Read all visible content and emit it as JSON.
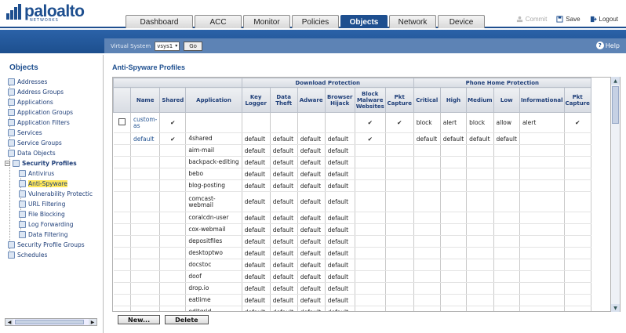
{
  "brand": {
    "name": "paloalto",
    "sub": "NETWORKS"
  },
  "tabs": [
    {
      "label": "Dashboard",
      "active": false
    },
    {
      "label": "ACC",
      "active": false
    },
    {
      "label": "Monitor",
      "active": false
    },
    {
      "label": "Policies",
      "active": false
    },
    {
      "label": "Objects",
      "active": true
    },
    {
      "label": "Network",
      "active": false
    },
    {
      "label": "Device",
      "active": false
    }
  ],
  "top_actions": {
    "commit": "Commit",
    "save": "Save",
    "logout": "Logout"
  },
  "vsys": {
    "label": "Virtual System",
    "value": "vsys1",
    "go": "Go"
  },
  "help": "Help",
  "sidebar": {
    "title": "Objects",
    "items": [
      {
        "label": "Addresses",
        "icon": "address-icon"
      },
      {
        "label": "Address Groups",
        "icon": "address-group-icon"
      },
      {
        "label": "Applications",
        "icon": "applications-icon"
      },
      {
        "label": "Application Groups",
        "icon": "application-group-icon"
      },
      {
        "label": "Application Filters",
        "icon": "application-filter-icon"
      },
      {
        "label": "Services",
        "icon": "services-icon"
      },
      {
        "label": "Service Groups",
        "icon": "service-group-icon"
      },
      {
        "label": "Data Objects",
        "icon": "data-objects-icon"
      },
      {
        "label": "Security Profiles",
        "icon": "security-profiles-icon"
      },
      {
        "label": "Antivirus",
        "icon": "antivirus-icon"
      },
      {
        "label": "Anti-Spyware",
        "icon": "anti-spyware-icon"
      },
      {
        "label": "Vulnerability Protectic",
        "icon": "vulnerability-icon"
      },
      {
        "label": "URL Filtering",
        "icon": "url-filtering-icon"
      },
      {
        "label": "File Blocking",
        "icon": "file-blocking-icon"
      },
      {
        "label": "Log Forwarding",
        "icon": "log-forwarding-icon"
      },
      {
        "label": "Data Filtering",
        "icon": "data-filtering-icon"
      },
      {
        "label": "Security Profile Groups",
        "icon": "security-profile-group-icon"
      },
      {
        "label": "Schedules",
        "icon": "schedules-icon"
      }
    ]
  },
  "page_title": "Anti-Spyware Profiles",
  "grid": {
    "group_headers": {
      "download": "Download Protection",
      "phone": "Phone Home Protection"
    },
    "columns": {
      "name": "Name",
      "shared": "Shared",
      "application": "Application",
      "key_logger": "Key Logger",
      "data_theft": "Data Theft",
      "adware": "Adware",
      "browser_hijack": "Browser Hijack",
      "block_malware": "Block Malware Websites",
      "pkt_capture": "Pkt Capture",
      "critical": "Critical",
      "high": "High",
      "medium": "Medium",
      "low": "Low",
      "informational": "Informational",
      "pkt_capture2": "Pkt Capture"
    },
    "custom_row": {
      "name": "custom-as",
      "shared": "✔",
      "block_malware": "✔",
      "pkt_capture": "✔",
      "critical": "block",
      "high": "alert",
      "medium": "block",
      "low": "allow",
      "informational": "alert",
      "pkt_capture2": "✔"
    },
    "default_row": {
      "name": "default",
      "shared": "✔",
      "block_malware": "✔",
      "critical": "default",
      "high": "default",
      "medium": "default",
      "low": "default"
    },
    "apps": [
      "4shared",
      "aim-mail",
      "backpack-editing",
      "bebo",
      "blog-posting",
      "comcast-webmail",
      "coralcdn-user",
      "cox-webmail",
      "depositfiles",
      "desktoptwo",
      "docstoc",
      "doof",
      "drop.io",
      "eatlime",
      "editgrid"
    ],
    "app_value": "default"
  },
  "buttons": {
    "new": "New...",
    "delete": "Delete"
  }
}
